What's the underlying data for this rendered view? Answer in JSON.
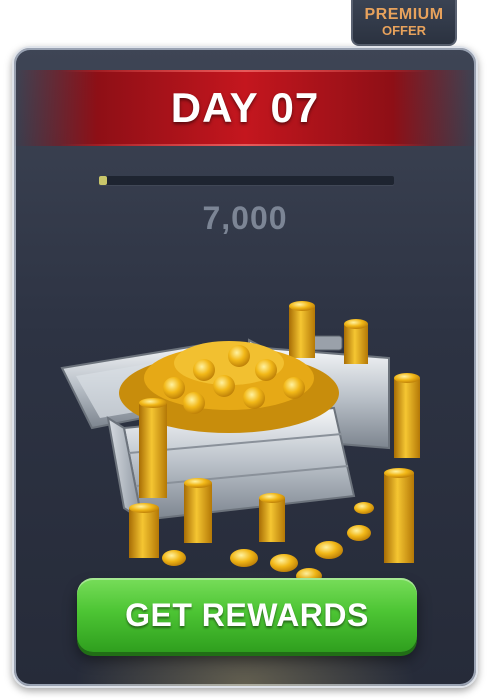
{
  "premium_tag": {
    "line1": "PREMIUM",
    "line2": "OFFER"
  },
  "reward": {
    "day_title": "DAY 07",
    "amount": "7,000",
    "progress_fraction": 0.027,
    "image_icon": "coin-treasure-chests"
  },
  "actions": {
    "get_rewards_label": "GET REWARDS"
  },
  "colors": {
    "banner_red": "#c4161e",
    "button_green": "#4dc534",
    "premium_text": "#e7a25c",
    "card_bg": "#2d3343",
    "coin_gold": "#f2b818"
  }
}
